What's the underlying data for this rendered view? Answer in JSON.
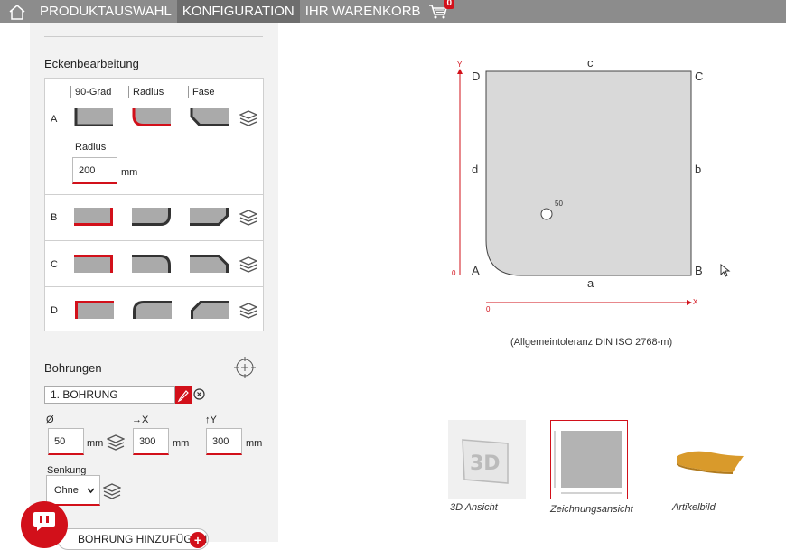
{
  "nav": {
    "tabs": [
      {
        "label": "PRODUKTAUSWAHL"
      },
      {
        "label": "KONFIGURATION"
      },
      {
        "label": "IHR WARENKORB"
      }
    ],
    "cart_count": "0"
  },
  "corners": {
    "title": "Eckenbearbeitung",
    "columns": [
      "90-Grad",
      "Radius",
      "Fase"
    ],
    "rows": [
      "A",
      "B",
      "C",
      "D"
    ],
    "radius_label": "Radius",
    "radius_value": "200",
    "radius_unit": "mm"
  },
  "drillings": {
    "title": "Bohrungen",
    "selected": "1. BOHRUNG",
    "diameter_label": "Ø",
    "x_label": "→X",
    "y_label": "↑Y",
    "diameter": "50",
    "x": "300",
    "y": "300",
    "unit": "mm",
    "countersink_label": "Senkung",
    "countersink_value": "Ohne",
    "add_label": "BOHRUNG HINZUFÜGEN"
  },
  "drawing": {
    "corners": {
      "tl": "D",
      "tr": "C",
      "bl": "A",
      "br": "B"
    },
    "edges": {
      "top": "c",
      "right": "b",
      "bottom": "a",
      "left": "d"
    },
    "hole_label": "50",
    "axis_y": "Y",
    "axis_x": "X",
    "origin_y": "0",
    "origin_x": "0",
    "tolerance": "(Allgemeintoleranz DIN ISO 2768-m)"
  },
  "views": [
    {
      "caption": "3D Ansicht",
      "icon_text": "3D"
    },
    {
      "caption": "Zeichnungsansicht"
    },
    {
      "caption": "Artikelbild"
    }
  ],
  "colors": {
    "accent": "#d2101a",
    "nav_bg": "#8c8c8c",
    "nav_active": "#6e6e6e"
  }
}
